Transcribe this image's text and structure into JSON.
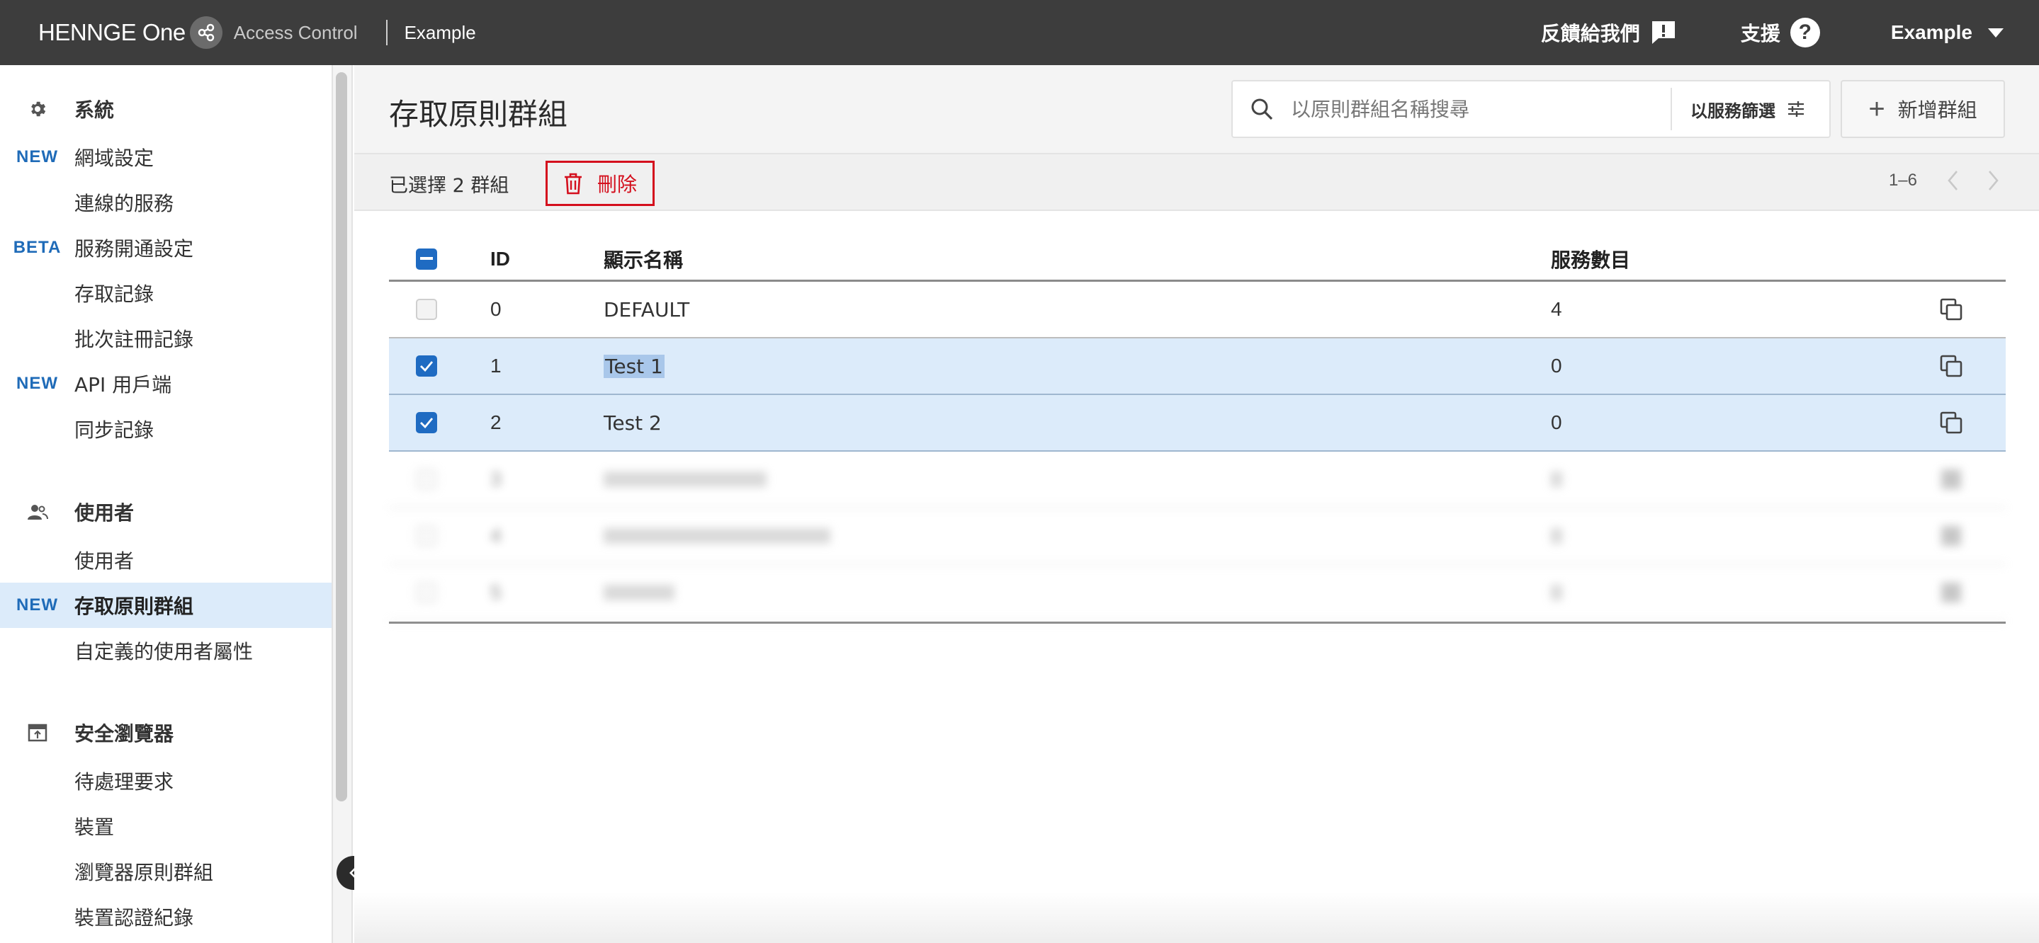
{
  "topbar": {
    "brand_name": "HENNGE One",
    "product": "Access Control",
    "tenant": "Example",
    "feedback_label": "反饋給我們",
    "support_label": "支援",
    "user_menu_label": "Example"
  },
  "sidebar": {
    "sections": [
      {
        "label": "系統",
        "icon": "gear-icon"
      },
      {
        "label": "使用者",
        "icon": "users-icon"
      },
      {
        "label": "安全瀏覽器",
        "icon": "browser-icon"
      }
    ],
    "items": [
      {
        "badge": "NEW",
        "label": "網域設定"
      },
      {
        "badge": "",
        "label": "連線的服務"
      },
      {
        "badge": "BETA",
        "label": "服務開通設定"
      },
      {
        "badge": "",
        "label": "存取記錄"
      },
      {
        "badge": "",
        "label": "批次註冊記錄"
      },
      {
        "badge": "NEW",
        "label": "API 用戶端"
      },
      {
        "badge": "",
        "label": "同步記錄"
      },
      {
        "badge": "",
        "label": "使用者"
      },
      {
        "badge": "NEW",
        "label": "存取原則群組"
      },
      {
        "badge": "",
        "label": "自定義的使用者屬性"
      },
      {
        "badge": "",
        "label": "待處理要求"
      },
      {
        "badge": "",
        "label": "裝置"
      },
      {
        "badge": "",
        "label": "瀏覽器原則群組"
      },
      {
        "badge": "",
        "label": "裝置認證紀錄"
      }
    ],
    "active_item": "存取原則群組"
  },
  "main": {
    "title": "存取原則群組",
    "search_placeholder": "以原則群組名稱搜尋",
    "filter_label": "以服務篩選",
    "add_label": "新增群組",
    "selection_text": "已選擇 2 群組",
    "delete_label": "刪除",
    "pagination": "1–6",
    "columns": [
      "ID",
      "顯示名稱",
      "服務數目"
    ],
    "rows": [
      {
        "id": "0",
        "name": "DEFAULT",
        "count": "4",
        "checked": false
      },
      {
        "id": "1",
        "name": "Test 1",
        "count": "0",
        "checked": true
      },
      {
        "id": "2",
        "name": "Test 2",
        "count": "0",
        "checked": true
      },
      {
        "id": "3",
        "name": "",
        "count": "",
        "checked": false
      },
      {
        "id": "4",
        "name": "",
        "count": "",
        "checked": false
      },
      {
        "id": "5",
        "name": "",
        "count": "",
        "checked": false
      }
    ]
  },
  "colors": {
    "topbar_bg": "#3d3d3d",
    "accent_blue": "#1f6bc2",
    "badge_blue": "#1f6bb8",
    "delete_red": "#d40f1d",
    "selected_row_bg": "#dcebfa"
  }
}
